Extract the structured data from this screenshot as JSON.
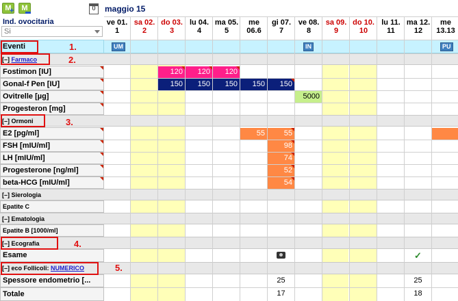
{
  "header": {
    "month": "maggio 15",
    "calendar_icon_text": "0",
    "ind_label": "Ind. ovocitaria",
    "select_value": "Si",
    "add_icon_letter": "M",
    "remove_icon_letter": "M"
  },
  "days": [
    {
      "day": "ve 01.",
      "num": "1",
      "weekend": false
    },
    {
      "day": "sa 02.",
      "num": "2",
      "weekend": true
    },
    {
      "day": "do 03.",
      "num": "3",
      "weekend": true
    },
    {
      "day": "lu 04.",
      "num": "4",
      "weekend": false
    },
    {
      "day": "ma 05.",
      "num": "5",
      "weekend": false
    },
    {
      "day": "me",
      "num": "06.6",
      "weekend": false
    },
    {
      "day": "gi 07.",
      "num": "7",
      "weekend": false
    },
    {
      "day": "ve 08.",
      "num": "8",
      "weekend": false
    },
    {
      "day": "sa 09.",
      "num": "9",
      "weekend": true
    },
    {
      "day": "do 10.",
      "num": "10",
      "weekend": true
    },
    {
      "day": "lu 11.",
      "num": "11",
      "weekend": false
    },
    {
      "day": "ma 12.",
      "num": "12",
      "weekend": false
    },
    {
      "day": "me",
      "num": "13.13",
      "weekend": false
    }
  ],
  "eventi": {
    "label": "Eventi",
    "badges": [
      {
        "text": "UM",
        "col": 0
      },
      {
        "text": "IN",
        "col": 7
      },
      {
        "text": "PU",
        "col": 12
      }
    ]
  },
  "sections": {
    "farmaco": "[–] Farmaco",
    "farmaco_prefix": "[–] ",
    "farmaco_link": "Farmaco",
    "ormoni": "[–] Ormoni",
    "sierologia": "[–] Sierologia",
    "ematologia": "[–] Ematologia",
    "ecografia": "[–] Ecografia",
    "follicoli_prefix": "[–] eco Follicoli: ",
    "follicoli_link": "NUMERICO"
  },
  "rows": {
    "fostimon": "Fostimon [IU]",
    "gonal": "Gonal-f Pen [IU]",
    "ovitrelle": "Ovitrelle [µg]",
    "progesteron": "Progesteron [mg]",
    "e2": "E2  [pg/ml]",
    "fsh": "FSH  [mIU/ml]",
    "lh": "LH  [mIU/ml]",
    "progesterone": "Progesterone  [ng/ml]",
    "bhcg": "beta-HCG  [mIU/ml]",
    "epatite_c": "Epatite C",
    "epatite_b": "Epatite B  [1000/ml]",
    "esame": "Esame",
    "spessore": "Spessore endometrio [...",
    "totale": "Totale"
  },
  "values": {
    "fostimon": [
      "120",
      "120",
      "120"
    ],
    "gonal": [
      "150",
      "150",
      "150",
      "150",
      "150"
    ],
    "ovitrelle": "5000",
    "e2": [
      "55",
      "55"
    ],
    "fsh": "98",
    "lh": "74",
    "progesterone": "52",
    "bhcg": "54",
    "spessore": [
      "25",
      "25"
    ],
    "totale": [
      "17",
      "18"
    ]
  },
  "annotations": [
    "1.",
    "2.",
    "3.",
    "4.",
    "5."
  ],
  "colors": {
    "eventi_bg": "#c7f2ff",
    "weekend_bg": "#ffffb8",
    "fostimon": "#ff1f8a",
    "gonal": "#0b1f7a",
    "ovitrelle": "#c6ef8c",
    "lab": "#ff8844",
    "annotation": "#e01010"
  }
}
